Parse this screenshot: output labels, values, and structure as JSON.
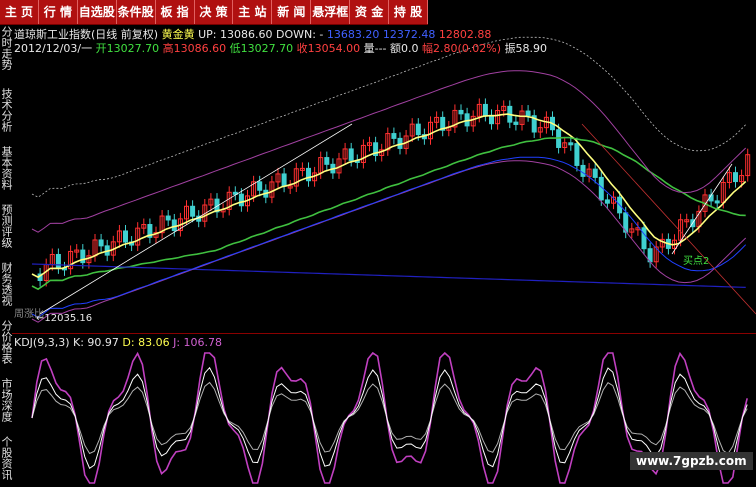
{
  "menu": [
    "主 页",
    "行 情",
    "自选股",
    "条件股",
    "板 指",
    "决 策",
    "主 站",
    "新 闻",
    "悬浮框",
    "资 金",
    "持 股"
  ],
  "sidebar": [
    "分时走势",
    "技术分析",
    "基本资料",
    "预测评级",
    "财务透视",
    "分价格表",
    "市场深度",
    "个股资讯"
  ],
  "header": {
    "index_name": "道琼斯工业指数(日线 前复权)",
    "indicator": "黄金黄",
    "up_label": "UP: 13086.60",
    "down_label": "DOWN: -",
    "v1": "13683.20",
    "v2": "12372.48",
    "v3": "12802.88"
  },
  "ohlc": {
    "date": "2012/12/03/一",
    "open": "开13027.70",
    "high": "高13086.60",
    "low": "低13027.70",
    "close": "收13054.00",
    "vol": "量---",
    "amt": "额0.0",
    "chg": "幅2.80(0.02%)",
    "amp": "振58.90"
  },
  "annotations": {
    "low_price": "←12035.16",
    "buy_point": "买点2",
    "marker": "周涨比"
  },
  "kdj": {
    "name": "KDJ(9,3,3)",
    "k": "K: 90.97",
    "d": "D: 83.06",
    "j": "J: 106.78"
  },
  "watermark": "www.7gpzb.com",
  "colors": {
    "up": "#ff3030",
    "down": "#40d0d0",
    "ma_yellow": "#ffff80",
    "ma_green": "#40c040",
    "ma_blue": "#2020c0",
    "k": "#ffffff",
    "d": "#c0c0c0",
    "j": "#c040c0"
  }
}
